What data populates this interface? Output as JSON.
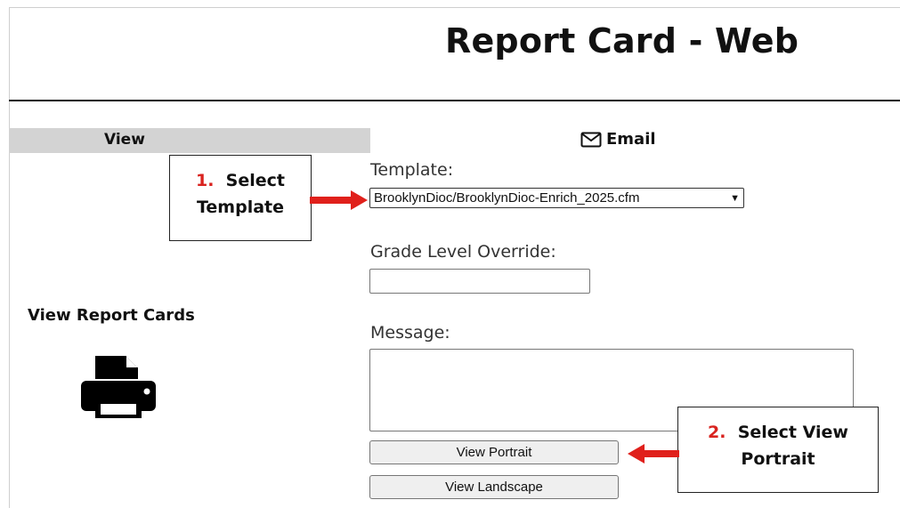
{
  "header": {
    "title": "Report Card - Web"
  },
  "sidebar": {
    "tab_label": "View",
    "section_title": "View Report Cards",
    "icon": "printer-icon"
  },
  "email_tab": {
    "label": "Email",
    "icon": "envelope-icon"
  },
  "form": {
    "template_label": "Template:",
    "template_value": "BrooklynDioc/BrooklynDioc-Enrich_2025.cfm",
    "grade_override_label": "Grade Level Override:",
    "grade_override_value": "",
    "message_label": "Message:",
    "message_value": "",
    "view_portrait_label": "View Portrait",
    "view_landscape_label": "View Landscape"
  },
  "callouts": [
    {
      "number": "1.",
      "line1": "Select",
      "line2": "Template"
    },
    {
      "number": "2.",
      "line1": "Select View",
      "line2": "Portrait"
    }
  ],
  "colors": {
    "callout_number": "#d9231f",
    "arrow": "#e0201b",
    "tab_bg": "#d3d3d3"
  }
}
